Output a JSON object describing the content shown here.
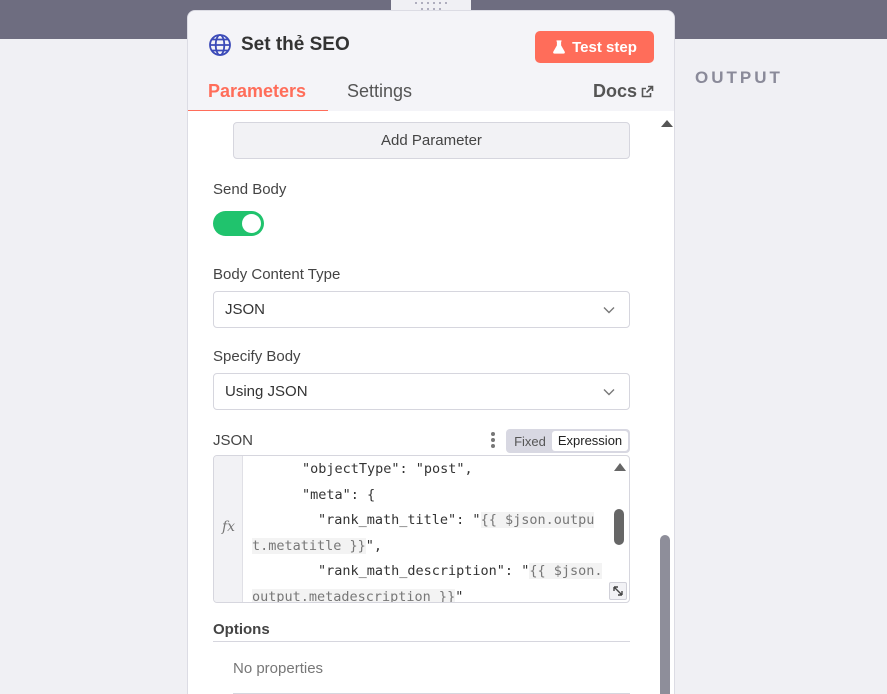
{
  "node": {
    "title": "Set thẻ SEO",
    "test_button": "Test step"
  },
  "tabs": [
    {
      "label": "Parameters"
    },
    {
      "label": "Settings"
    },
    {
      "label": "Docs"
    }
  ],
  "output_title": "OUTPUT",
  "params": {
    "add_parameter": "Add Parameter",
    "send_body_label": "Send Body",
    "send_body_enabled": true,
    "body_content_type_label": "Body Content Type",
    "body_content_type_value": "JSON",
    "specify_body_label": "Specify Body",
    "specify_body_value": "Using JSON",
    "json_label": "JSON",
    "mode_fixed": "Fixed",
    "mode_expression": "Expression",
    "json_lines": [
      {
        "text": "\"objectType\": \"post\","
      },
      {
        "text": "\"meta\": {"
      },
      {
        "text_a": "\"rank_math_title\": \"",
        "expr_a": "{{ $json.outpu"
      },
      {
        "expr_b": "t.metatitle }}",
        "text_b": "\","
      },
      {
        "text_a": "\"rank_math_description\": \"",
        "expr_a": "{{ $json."
      },
      {
        "expr_b": "output.metadescription }}",
        "text_b": "\""
      }
    ],
    "options_label": "Options",
    "no_properties": "No properties"
  },
  "colors": {
    "accent": "#ff6d5a",
    "toggle_on": "#20c36d"
  }
}
